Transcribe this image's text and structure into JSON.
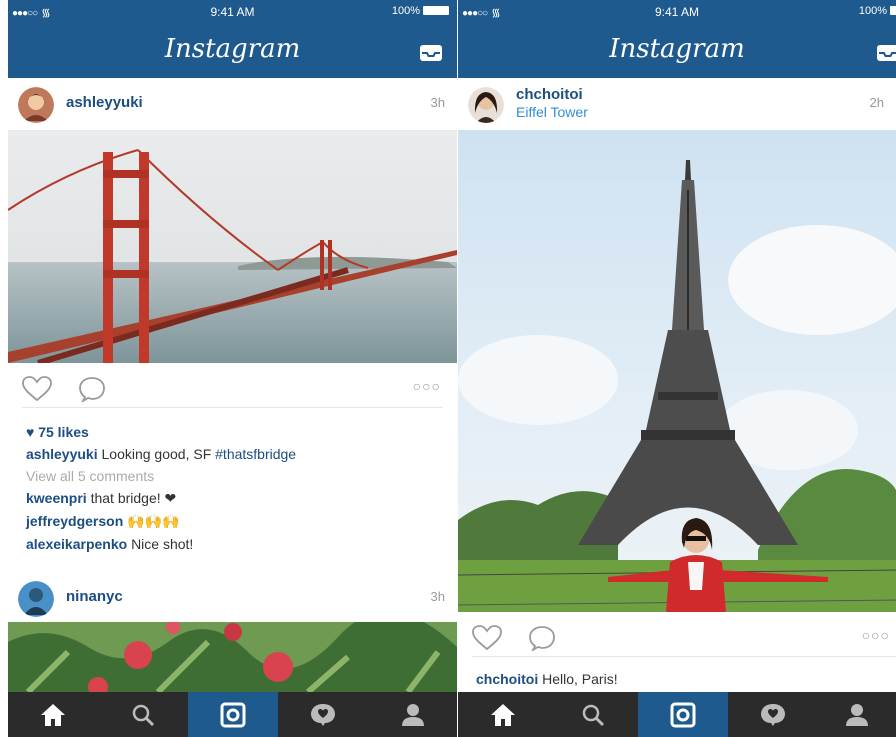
{
  "screens": [
    {
      "status": {
        "signal": "●●●○○",
        "time": "9:41 AM",
        "battery": "100%"
      },
      "app_title": "Instagram",
      "post": {
        "username": "ashleyyuki",
        "time_ago": "3h",
        "likes": "75 likes",
        "caption": {
          "user": "ashleyyuki",
          "text": "Looking good, SF",
          "hashtag": "#thatsfbridge"
        },
        "view_all": "View all 5 comments",
        "comments": [
          {
            "user": "kweenpri",
            "text": "that bridge! ❤"
          },
          {
            "user": "jeffreydgerson",
            "text": "🙌🙌🙌"
          },
          {
            "user": "alexeikarpenko",
            "text": "Nice shot!"
          }
        ],
        "more": "○○○"
      },
      "next_post": {
        "username": "ninanyc",
        "time_ago": "3h"
      },
      "tabs": [
        "home-icon",
        "search-icon",
        "camera-icon",
        "activity-icon",
        "profile-icon"
      ],
      "colors": {
        "header": "#1f5a8e",
        "tabbar": "#2b2b2b",
        "active_tab": "#1f5a8e",
        "username": "#1c4e82"
      }
    },
    {
      "status": {
        "signal": "●●●○○",
        "time": "9:41 AM",
        "battery": "100%"
      },
      "app_title": "Instagram",
      "post": {
        "username": "chchoitoi",
        "location": "Eiffel Tower",
        "time_ago": "2h",
        "more": "○○○",
        "caption": {
          "user": "chchoitoi",
          "text": "Hello, Paris!"
        }
      }
    }
  ]
}
